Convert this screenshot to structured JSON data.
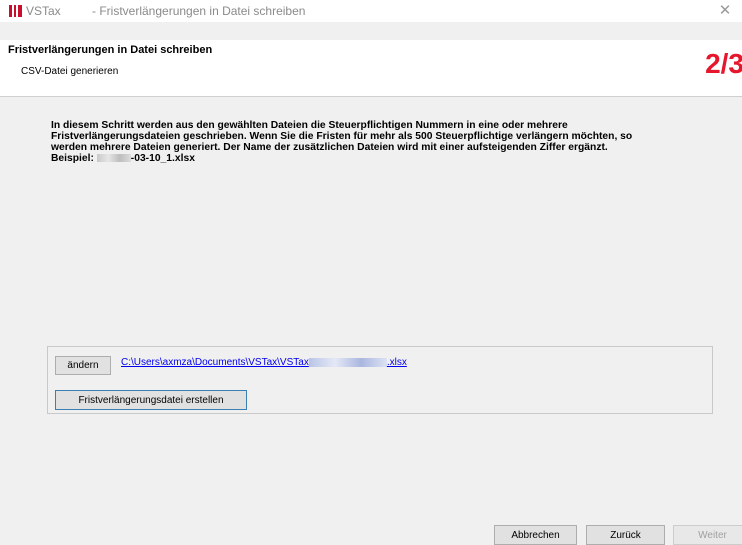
{
  "window": {
    "app_name": "VSTax",
    "separator": "-",
    "title": "Fristverlängerungen in Datei schreiben",
    "close_glyph": "✕"
  },
  "header": {
    "title": "Fristverlängerungen in Datei schreiben",
    "subtitle": "CSV-Datei generieren",
    "step": "2/3",
    "step_color": "#e6162d"
  },
  "description": {
    "line1": "In diesem Schritt werden aus den gewählten Dateien die Steuerpflichtigen Nummern in eine oder mehrere",
    "line2": "Fristverlängerungsdateien geschrieben. Wenn Sie die Fristen für mehr als 500 Steuerpflichtige verlängern möchten, so",
    "line3": "werden mehrere Dateien generiert. Der Name der zusätzlichen Dateien wird mit einer aufsteigenden Ziffer ergänzt.",
    "example_label": "Beispiel:",
    "example_suffix": "-03-10_1.xlsx"
  },
  "file_group": {
    "change_button": "ändern",
    "path_prefix": "C:\\Users\\axmza\\Documents\\VSTax\\VSTax",
    "path_suffix": ".xlsx",
    "create_button": "Fristverlängerungsdatei erstellen"
  },
  "footer": {
    "cancel": "Abbrechen",
    "back": "Zurück",
    "next": "Weiter"
  }
}
